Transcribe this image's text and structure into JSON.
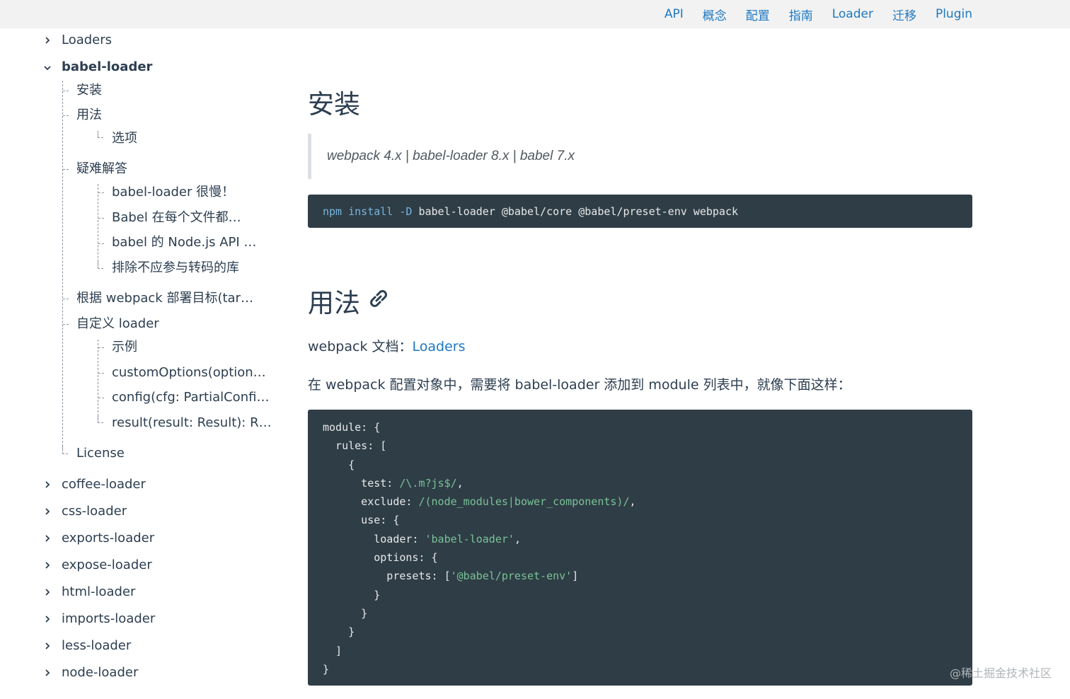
{
  "topnav": {
    "items": [
      "API",
      "概念",
      "配置",
      "指南",
      "Loader",
      "迁移",
      "Plugin"
    ]
  },
  "sidebar": {
    "loaders": "Loaders",
    "babel_loader": "babel-loader",
    "install": "安装",
    "usage": "用法",
    "options": "选项",
    "troubleshooting": "疑难解答",
    "slow": "babel-loader 很慢！",
    "every_file": "Babel 在每个文件都…",
    "nodejs_api": "babel 的 Node.js API …",
    "exclude_libs": "排除不应参与转码的库",
    "targets": "根据 webpack 部署目标(tar…",
    "custom_loader": "自定义 loader",
    "example": "示例",
    "custom_options": "customOptions(option…",
    "config_fn": "config(cfg: PartialConfi…",
    "result_fn": "result(result: Result): R…",
    "license": "License",
    "coffee": "coffee-loader",
    "css": "css-loader",
    "exports": "exports-loader",
    "expose": "expose-loader",
    "html": "html-loader",
    "imports": "imports-loader",
    "less": "less-loader",
    "node": "node-loader"
  },
  "content": {
    "install_heading": "安装",
    "quote": "webpack 4.x | babel-loader 8.x | babel 7.x",
    "npm_cmd": "npm",
    "npm_sub": "install",
    "npm_flag": "-D",
    "npm_rest": "babel-loader @babel/core @babel/preset-env webpack",
    "usage_heading": "用法",
    "docs_label": "webpack 文档：",
    "docs_link": "Loaders",
    "usage_para": "在 webpack 配置对象中，需要将 babel-loader 添加到 module 列表中，就像下面这样：",
    "code": {
      "l1": "module: {",
      "l2": "  rules: [",
      "l3": "    {",
      "l4a": "      test: ",
      "l4b": "/\\.m?js$/",
      "l4c": ",",
      "l5a": "      exclude: ",
      "l5b": "/(node_modules|bower_components)/",
      "l5c": ",",
      "l6": "      use: {",
      "l7a": "        loader: ",
      "l7b": "'babel-loader'",
      "l7c": ",",
      "l8": "        options: {",
      "l9a": "          presets: [",
      "l9b": "'@babel/preset-env'",
      "l9c": "]",
      "l10": "        }",
      "l11": "      }",
      "l12": "    }",
      "l13": "  ]",
      "l14": "}"
    }
  },
  "watermark": "@稀土掘金技术社区",
  "colors": {
    "link": "#1d78c1",
    "code_bg": "#2f3d46",
    "text": "#2c3e50"
  }
}
